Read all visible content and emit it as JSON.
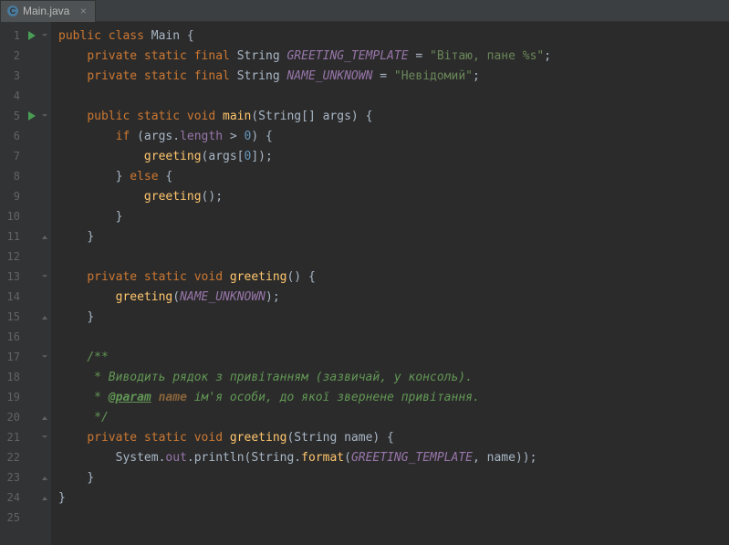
{
  "tab": {
    "filename": "Main.java",
    "close_glyph": "×"
  },
  "gutter": {
    "lines": 25,
    "run_markers": [
      1,
      5
    ],
    "fold_open": [
      1,
      5,
      13,
      17,
      21
    ],
    "fold_close": [
      11,
      15,
      20,
      23,
      24
    ]
  },
  "code": {
    "l1": {
      "kw1": "public class ",
      "name": "Main {"
    },
    "l2": {
      "indent": "    ",
      "kw": "private static final ",
      "type": "String ",
      "const": "GREETING_TEMPLATE",
      "rest": " = ",
      "str": "\"Вітаю, пане %s\"",
      "semi": ";"
    },
    "l3": {
      "indent": "    ",
      "kw": "private static final ",
      "type": "String ",
      "const": "NAME_UNKNOWN",
      "rest": " = ",
      "str": "\"Невідомий\"",
      "semi": ";"
    },
    "l4": {
      "text": ""
    },
    "l5": {
      "indent": "    ",
      "kw": "public static void ",
      "method": "main",
      "params": "(String[] args) {"
    },
    "l6": {
      "indent": "        ",
      "kw": "if ",
      "rest": "(args.",
      "field": "length",
      "rest2": " > ",
      "num": "0",
      "rest3": ") {"
    },
    "l7": {
      "indent": "            ",
      "method": "greeting",
      "rest": "(args[",
      "num": "0",
      "rest2": "]);"
    },
    "l8": {
      "indent": "        ",
      "text": "} ",
      "kw": "else ",
      "brace": "{"
    },
    "l9": {
      "indent": "            ",
      "method": "greeting",
      "rest": "();"
    },
    "l10": {
      "indent": "        ",
      "text": "}"
    },
    "l11": {
      "indent": "    ",
      "text": "}"
    },
    "l12": {
      "text": ""
    },
    "l13": {
      "indent": "    ",
      "kw": "private static void ",
      "method": "greeting",
      "params": "() {"
    },
    "l14": {
      "indent": "        ",
      "method": "greeting",
      "paren": "(",
      "const": "NAME_UNKNOWN",
      "rest": ");"
    },
    "l15": {
      "indent": "    ",
      "text": "}"
    },
    "l16": {
      "text": ""
    },
    "l17": {
      "indent": "    ",
      "comment": "/**"
    },
    "l18": {
      "indent": "     ",
      "comment": "* Виводить рядок з привітанням (зазвичай, у консоль)."
    },
    "l19": {
      "indent": "     ",
      "prefix": "* ",
      "doctag": "@param",
      "space": " ",
      "paramname": "name",
      "rest": " ім'я особи, до якої звернене привітання."
    },
    "l20": {
      "indent": "     ",
      "comment": "*/"
    },
    "l21": {
      "indent": "    ",
      "kw": "private static void ",
      "method": "greeting",
      "params": "(String name) {"
    },
    "l22": {
      "indent": "        ",
      "text1": "System.",
      "field": "out",
      "text2": ".println(String.",
      "method": "format",
      "paren": "(",
      "const": "GREETING_TEMPLATE",
      "text3": ", name));"
    },
    "l23": {
      "indent": "    ",
      "text": "}"
    },
    "l24": {
      "text": "}"
    },
    "l25": {
      "text": ""
    }
  }
}
